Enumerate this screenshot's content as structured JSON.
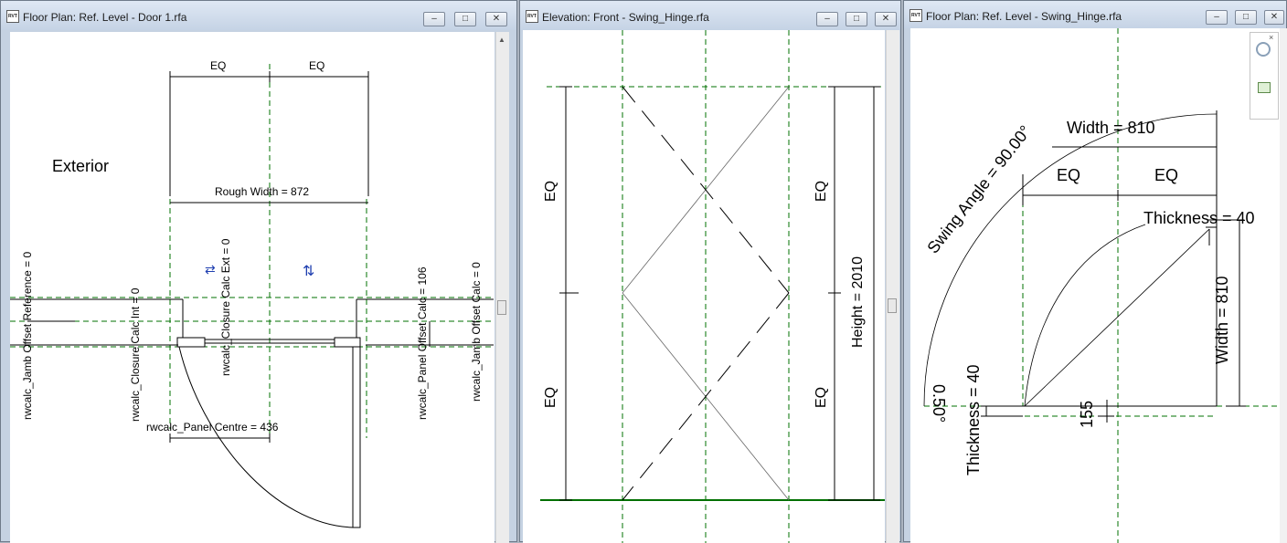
{
  "windows": [
    {
      "title": "Floor Plan: Ref. Level - Door 1.rfa",
      "icon": "revit-file-icon",
      "icon_text": "RVT"
    },
    {
      "title": "Elevation: Front - Swing_Hinge.rfa",
      "icon": "revit-file-icon",
      "icon_text": "RVT"
    },
    {
      "title": "Floor Plan: Ref. Level - Swing_Hinge.rfa",
      "icon": "revit-file-icon",
      "icon_text": "RVT"
    }
  ],
  "controls": {
    "minimize": "–",
    "restore": "□",
    "close": "✕"
  },
  "door1": {
    "eq_left": "EQ",
    "eq_right": "EQ",
    "exterior_label": "Exterior",
    "rough_width": "Rough Width = 872",
    "jamb_offset_reference": "rwcalc_Jamb Offset Reference = 0",
    "closure_calc_int": "rwcalc_Closure Calc Int = 0",
    "closure_calc_ext": "rwcalc_Closure Calc Ext = 0",
    "panel_offset_calc": "rwcalc_Panel Offset Calc = 106",
    "jamb_offset_calc": "rwcalc_Jamb Offset Calc = 0",
    "panel_centre": "rwcalc_Panel Centre = 436",
    "flip_symbol_left": "⇄",
    "flip_symbol_right": "⇅"
  },
  "elevation": {
    "eq_top_left": "EQ",
    "eq_bottom_left": "EQ",
    "eq_top_right": "EQ",
    "eq_bottom_right": "EQ",
    "height": "Height = 2010"
  },
  "swing_plan": {
    "swing_angle": "Swing Angle = 90.00°",
    "width_top": "Width = 810",
    "eq_left": "EQ",
    "eq_right": "EQ",
    "thickness_top": "Thickness = 40",
    "width_side": "Width = 810",
    "thickness_bottom": "Thickness = 40",
    "offset_angle": "0.50°",
    "dim_155": "155"
  },
  "colors": {
    "ref_plane": "#007000",
    "dim_line": "#000000",
    "background": "#ffffff",
    "title_bg": "#c5d3e5"
  }
}
